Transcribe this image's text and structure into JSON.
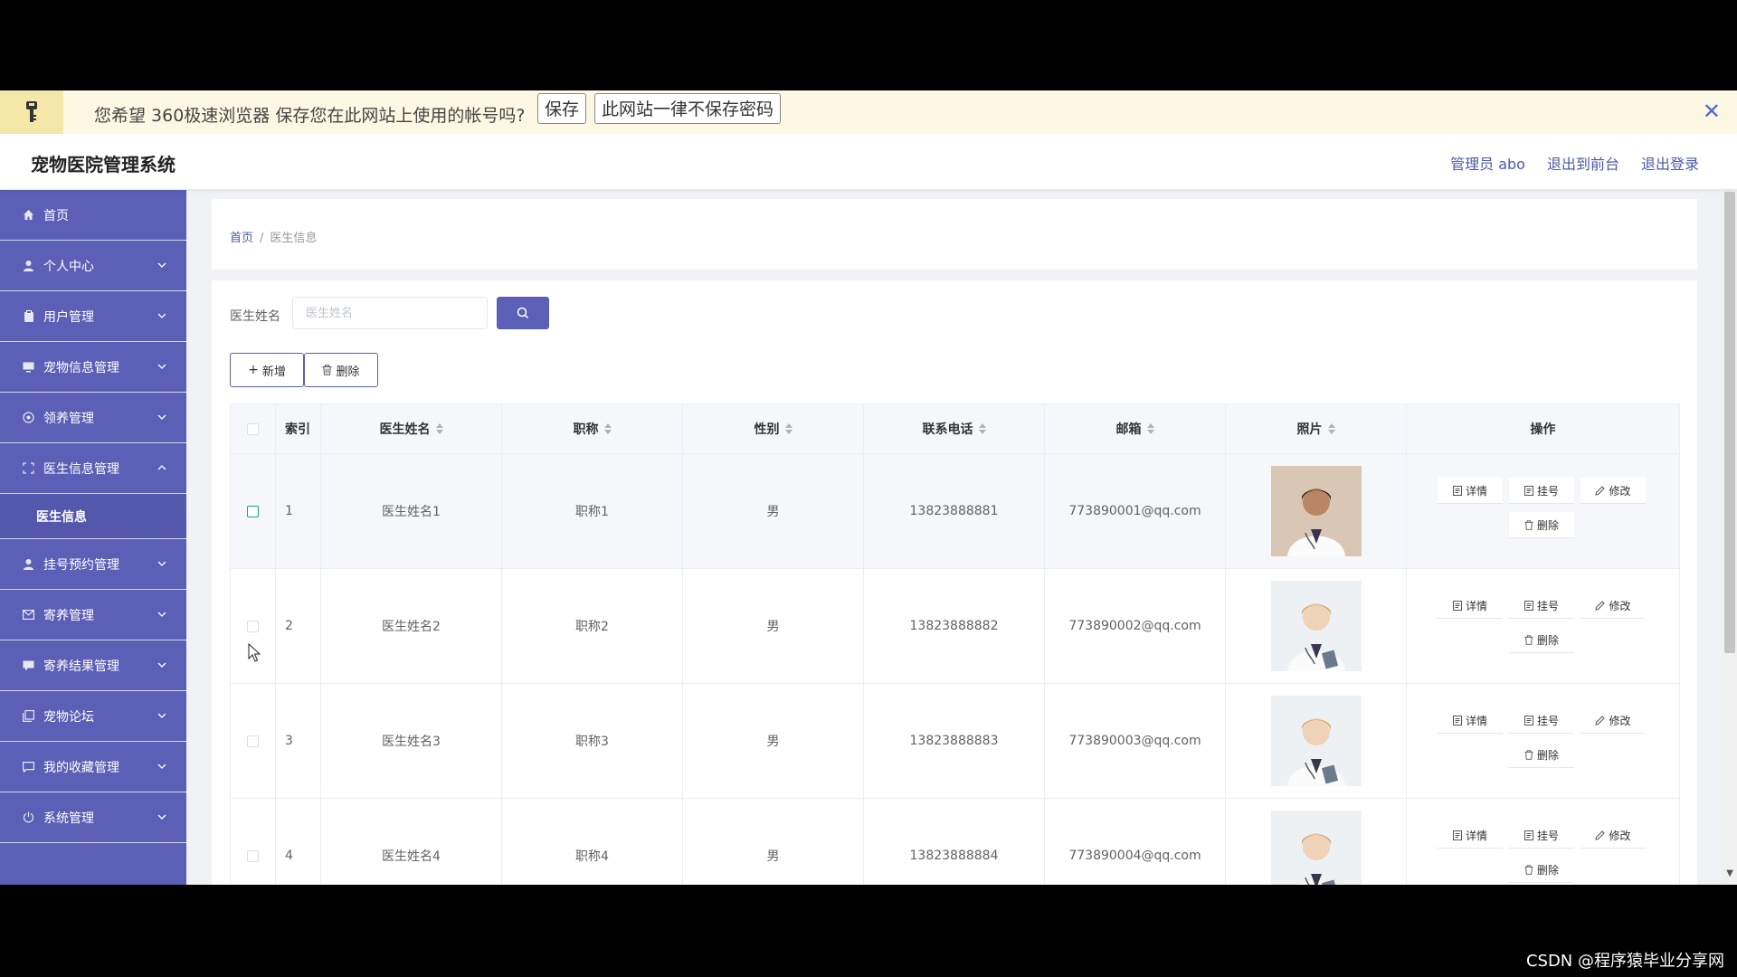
{
  "password_bar": {
    "message": "您希望 360极速浏览器 保存您在此网站上使用的帐号吗?",
    "save_label": "保存",
    "never_label": "此网站一律不保存密码",
    "close_label": "✕",
    "key_icon": "key-icon"
  },
  "header": {
    "title": "宠物医院管理系统",
    "user_label": "管理员 abo",
    "to_front_label": "退出到前台",
    "logout_label": "退出登录"
  },
  "sidebar": {
    "items": [
      {
        "label": "首页",
        "icon": "home-icon"
      },
      {
        "label": "个人中心",
        "icon": "user-icon"
      },
      {
        "label": "用户管理",
        "icon": "clipboard-icon"
      },
      {
        "label": "宠物信息管理",
        "icon": "monitor-icon"
      },
      {
        "label": "领养管理",
        "icon": "target-icon"
      },
      {
        "label": "医生信息管理",
        "icon": "scan-icon",
        "expanded": true,
        "sub": "医生信息"
      },
      {
        "label": "挂号预约管理",
        "icon": "user-icon"
      },
      {
        "label": "寄养管理",
        "icon": "mail-icon"
      },
      {
        "label": "寄养结果管理",
        "icon": "chat-icon"
      },
      {
        "label": "宠物论坛",
        "icon": "copy-icon"
      },
      {
        "label": "我的收藏管理",
        "icon": "message-icon"
      },
      {
        "label": "系统管理",
        "icon": "power-icon"
      }
    ]
  },
  "breadcrumb": {
    "home": "首页",
    "separator": "/",
    "current": "医生信息"
  },
  "search": {
    "label": "医生姓名",
    "placeholder": "医生姓名"
  },
  "toolbar": {
    "add_label": "新增",
    "delete_label": "删除"
  },
  "table": {
    "columns": [
      "索引",
      "医生姓名",
      "职称",
      "性别",
      "联系电话",
      "邮箱",
      "照片",
      "操作"
    ],
    "rows": [
      {
        "index": "1",
        "name": "医生姓名1",
        "title": "职称1",
        "gender": "男",
        "phone": "13823888881",
        "email": "773890001@qq.com",
        "checked_outline": true
      },
      {
        "index": "2",
        "name": "医生姓名2",
        "title": "职称2",
        "gender": "男",
        "phone": "13823888882",
        "email": "773890002@qq.com"
      },
      {
        "index": "3",
        "name": "医生姓名3",
        "title": "职称3",
        "gender": "男",
        "phone": "13823888883",
        "email": "773890003@qq.com"
      },
      {
        "index": "4",
        "name": "医生姓名4",
        "title": "职称4",
        "gender": "男",
        "phone": "13823888884",
        "email": "773890004@qq.com"
      }
    ],
    "actions": {
      "detail": "详情",
      "register": "挂号",
      "edit": "修改",
      "delete": "删除"
    }
  },
  "colors": {
    "sidebar_bg": "#5b5fb5",
    "accent": "#5b5fb5",
    "password_bar_bg": "#fdf8e3"
  },
  "watermark": "CSDN @程序猿毕业分享网"
}
